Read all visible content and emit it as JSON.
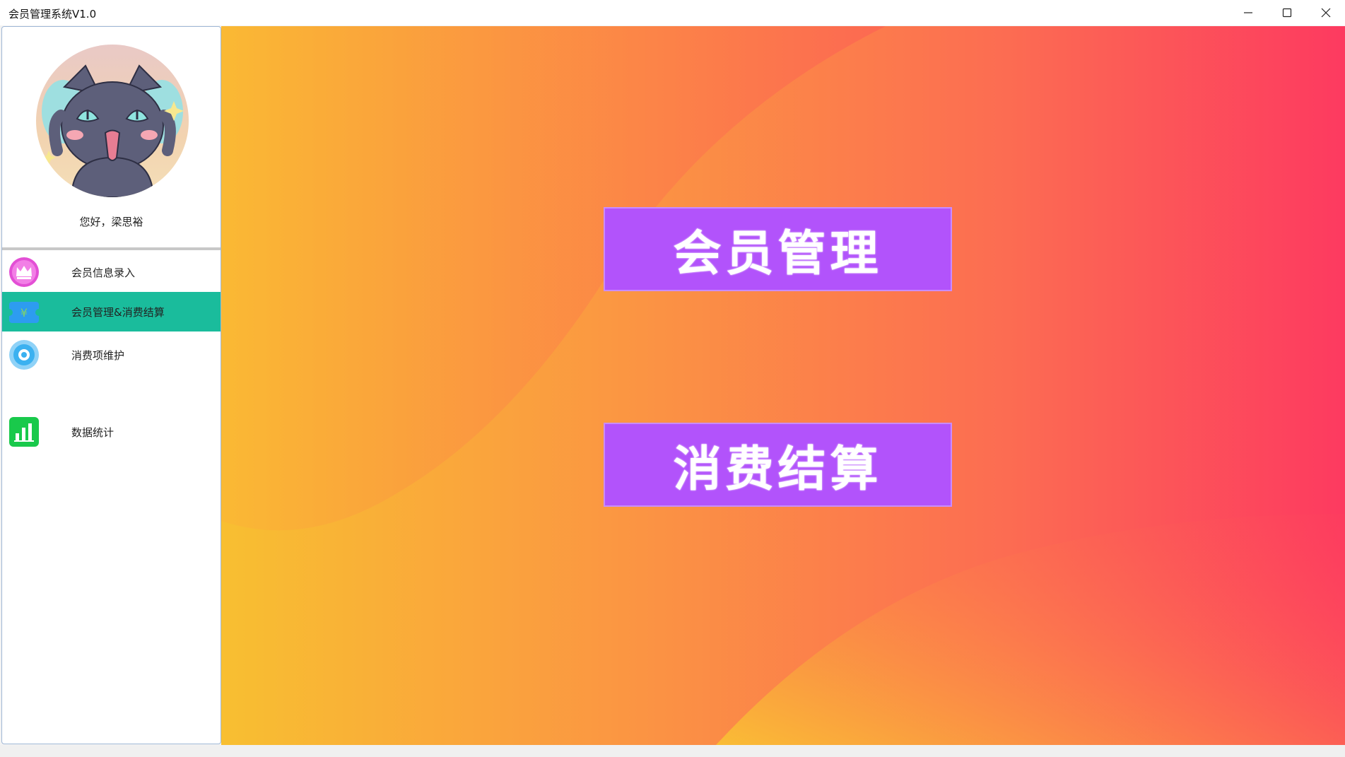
{
  "window": {
    "title": "会员管理系统V1.0"
  },
  "profile": {
    "greeting": "您好，梁思裕"
  },
  "sidebar": {
    "items": [
      {
        "label": "会员信息录入",
        "icon": "crown-icon",
        "color": "#e34fd5"
      },
      {
        "label": "会员管理&消费结算",
        "icon": "ticket-icon",
        "color": "#2d9cf0",
        "active": true
      },
      {
        "label": "消费项维护",
        "icon": "gear-icon",
        "color": "#3bb1f0"
      },
      {
        "label": "数据统计",
        "icon": "bar-chart-icon",
        "color": "#19c94b"
      }
    ]
  },
  "main": {
    "buttons": [
      {
        "label": "会员管理"
      },
      {
        "label": "消费结算"
      }
    ]
  },
  "colors": {
    "active_menu": "#1abc9c",
    "button_bg": "#b253fb",
    "gradient_start": "#f8bf31",
    "gradient_end": "#fd3a60"
  }
}
